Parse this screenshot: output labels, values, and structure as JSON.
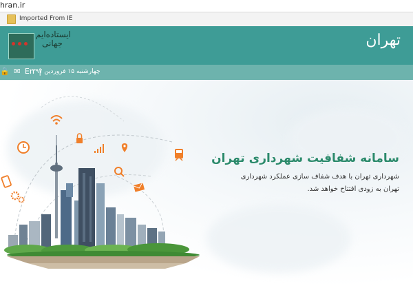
{
  "browser": {
    "address": "hran.ir",
    "favorites_item": "Imported From IE"
  },
  "header": {
    "logo_text": "تهران",
    "calligraphy": "ایستاده‌ایم جهانی",
    "date": "چهارشنبه ۱۵ فروردین ۱۳۹۷",
    "lang": "En",
    "separator": "|"
  },
  "hero": {
    "title": "سامانه شفافیت شهرداری تهران",
    "description": "شهرداری تهران با هدف شفاف سازی عملکرد شهرداری تهران به زودی افتتاح خواهد شد."
  },
  "colors": {
    "header": "#3e9c96",
    "subbar": "#6db3ad",
    "icon_orange": "#f07f2a",
    "title_green": "#2b8a6b"
  }
}
